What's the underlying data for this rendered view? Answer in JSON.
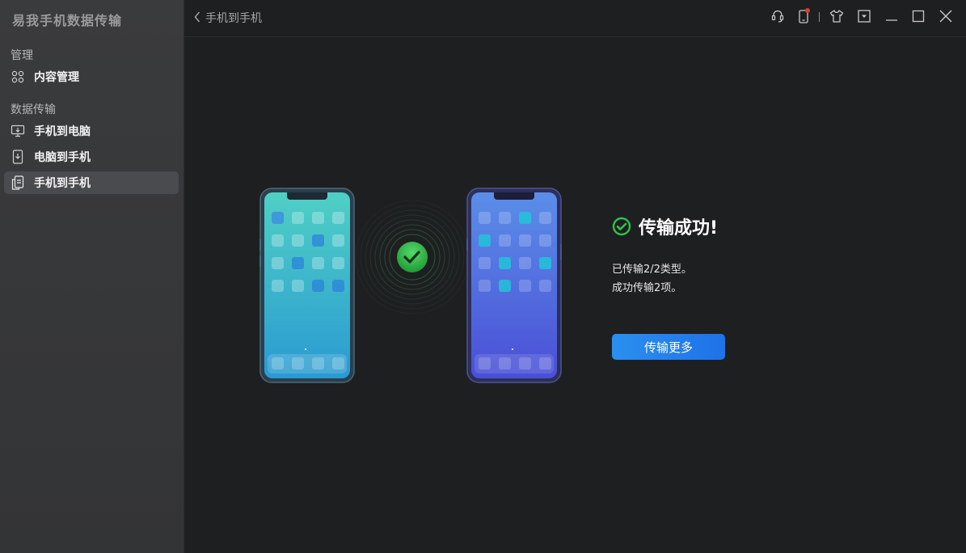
{
  "app": {
    "title": "易我手机数据传输"
  },
  "sidebar": {
    "sections": [
      {
        "label": "管理",
        "items": [
          {
            "label": "内容管理",
            "icon": "grid-icon"
          }
        ]
      },
      {
        "label": "数据传输",
        "items": [
          {
            "label": "手机到电脑",
            "icon": "phone-to-pc-icon"
          },
          {
            "label": "电脑到手机",
            "icon": "pc-to-phone-icon"
          },
          {
            "label": "手机到手机",
            "icon": "phone-to-phone-icon",
            "active": true
          }
        ]
      }
    ]
  },
  "header": {
    "back_label": "手机到手机",
    "toolbar": [
      "support-icon",
      "device-icon",
      "skin-icon",
      "menu-icon",
      "minimize-icon",
      "maximize-icon",
      "close-icon"
    ]
  },
  "result": {
    "title": "传输成功!",
    "line1": "已传输2/2类型。",
    "line2": "成功传输2项。",
    "button_label": "传输更多"
  },
  "colors": {
    "accent": "#1f7ae8",
    "success": "#2ec24a",
    "notification": "#e53935"
  }
}
